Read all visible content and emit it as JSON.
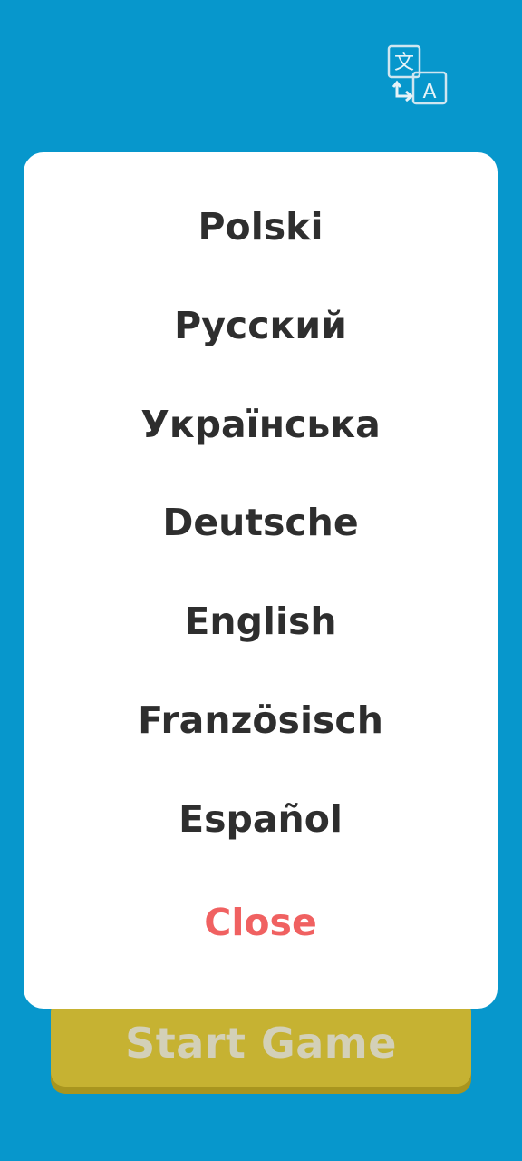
{
  "header": {
    "translate_icon": "translate-icon",
    "translate_glyph_a": "文",
    "translate_glyph_b": "A"
  },
  "language_menu": {
    "items": [
      {
        "label": "Polski"
      },
      {
        "label": "Русский"
      },
      {
        "label": "Українська"
      },
      {
        "label": "Deutsche"
      },
      {
        "label": "English"
      },
      {
        "label": "Französisch"
      },
      {
        "label": "Español"
      }
    ],
    "close_label": "Close"
  },
  "start": {
    "label": "Start Game"
  },
  "colors": {
    "background": "#0797cc",
    "modal": "#ffffff",
    "text": "#2e2e2e",
    "close": "#f06161",
    "button": "#c6b232",
    "button_text": "#d3d0b8"
  }
}
